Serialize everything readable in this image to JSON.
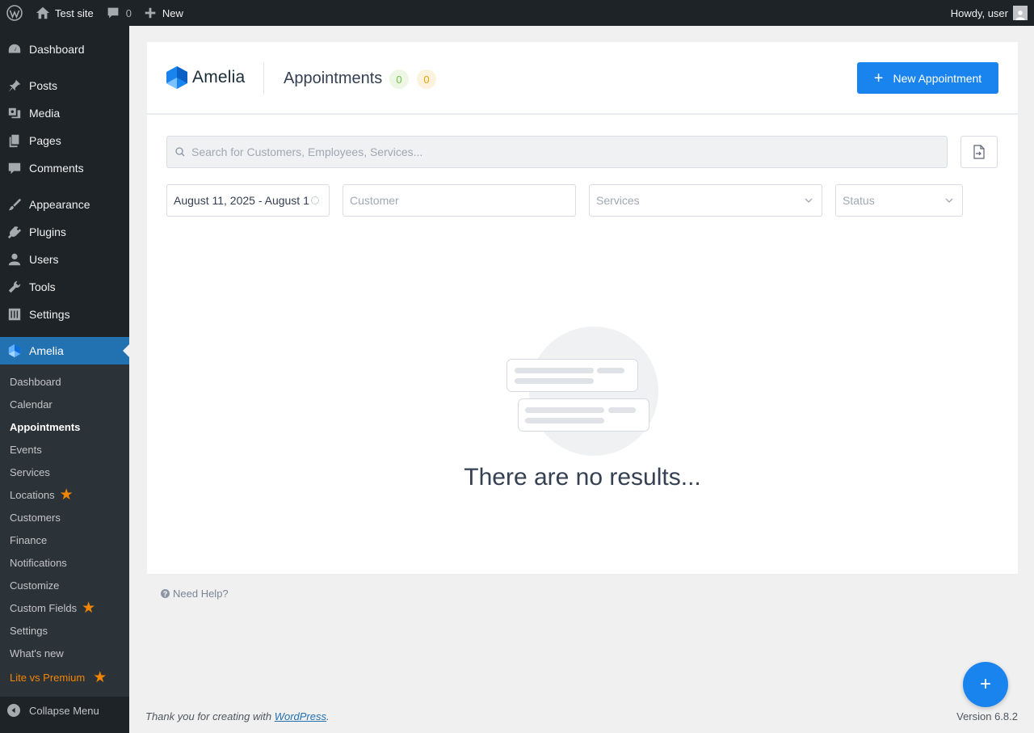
{
  "adminbar": {
    "site_name": "Test site",
    "comments_count": "0",
    "new_label": "New",
    "howdy": "Howdy, user"
  },
  "sidebar": {
    "items": [
      {
        "label": "Dashboard",
        "icon": "dashboard-icon"
      },
      {
        "label": "Posts",
        "icon": "pin-icon"
      },
      {
        "label": "Media",
        "icon": "media-icon"
      },
      {
        "label": "Pages",
        "icon": "pages-icon"
      },
      {
        "label": "Comments",
        "icon": "comment-icon"
      },
      {
        "label": "Appearance",
        "icon": "brush-icon"
      },
      {
        "label": "Plugins",
        "icon": "plug-icon"
      },
      {
        "label": "Users",
        "icon": "user-icon"
      },
      {
        "label": "Tools",
        "icon": "wrench-icon"
      },
      {
        "label": "Settings",
        "icon": "sliders-icon"
      },
      {
        "label": "Amelia",
        "icon": "amelia-icon"
      }
    ],
    "submenu": [
      {
        "label": "Dashboard"
      },
      {
        "label": "Calendar"
      },
      {
        "label": "Appointments"
      },
      {
        "label": "Events"
      },
      {
        "label": "Services"
      },
      {
        "label": "Locations"
      },
      {
        "label": "Customers"
      },
      {
        "label": "Finance"
      },
      {
        "label": "Notifications"
      },
      {
        "label": "Customize"
      },
      {
        "label": "Custom Fields"
      },
      {
        "label": "Settings"
      },
      {
        "label": "What's new"
      },
      {
        "label": "Lite vs Premium"
      }
    ],
    "collapse_label": "Collapse Menu"
  },
  "header": {
    "logo_text": "Amelia",
    "title": "Appointments",
    "badge_green": "0",
    "badge_orange": "0",
    "new_button": "New Appointment"
  },
  "filters": {
    "search_placeholder": "Search for Customers, Employees, Services...",
    "date_range": "August 11, 2025 - August 1",
    "customer_placeholder": "Customer",
    "services_placeholder": "Services",
    "status_placeholder": "Status"
  },
  "empty": {
    "message": "There are no results..."
  },
  "help": {
    "label": "Need Help?"
  },
  "footer": {
    "thanks_prefix": "Thank you for creating with ",
    "wordpress_link": "WordPress",
    "thanks_suffix": ".",
    "version": "Version 6.8.2"
  },
  "fab": {
    "label": "+"
  },
  "colors": {
    "accent": "#1a84ee",
    "wp_blue": "#2271b1",
    "admin_dark": "#1d2327",
    "orange": "#f18500"
  }
}
